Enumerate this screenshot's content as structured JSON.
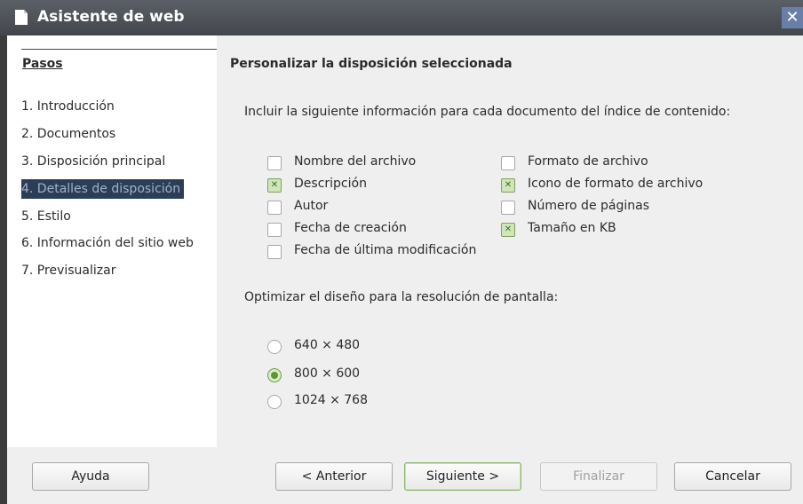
{
  "window": {
    "title": "Asistente de web",
    "close_glyph": "✕"
  },
  "steps": {
    "heading": "Pasos",
    "items": [
      {
        "label": "1. Introducción",
        "active": false
      },
      {
        "label": "2. Documentos",
        "active": false
      },
      {
        "label": "3. Disposición principal",
        "active": false
      },
      {
        "label": "4. Detalles de disposición",
        "active": true
      },
      {
        "label": "5. Estilo",
        "active": false
      },
      {
        "label": "6. Información del sitio web",
        "active": false
      },
      {
        "label": "7. Previsualizar",
        "active": false
      }
    ]
  },
  "main": {
    "title": "Personalizar la disposición seleccionada",
    "include_label": "Incluir la siguiente información para cada documento del índice de contenido:",
    "checkboxes": [
      {
        "label": "Nombre del archivo",
        "checked": false
      },
      {
        "label": "Descripción",
        "checked": true
      },
      {
        "label": "Autor",
        "checked": false
      },
      {
        "label": "Fecha de creación",
        "checked": false
      },
      {
        "label": "Fecha de última modificación",
        "checked": false
      },
      {
        "label": "Formato de archivo",
        "checked": false
      },
      {
        "label": "Icono de formato de archivo",
        "checked": true
      },
      {
        "label": "Número de páginas",
        "checked": false
      },
      {
        "label": "Tamaño en KB",
        "checked": true
      }
    ],
    "resolution_label": "Optimizar el diseño para la resolución de pantalla:",
    "resolutions": [
      {
        "label": "640 × 480",
        "selected": false
      },
      {
        "label": "800 × 600",
        "selected": true
      },
      {
        "label": "1024 × 768",
        "selected": false
      }
    ]
  },
  "buttons": {
    "help": "Ayuda",
    "back": "< Anterior",
    "next": "Siguiente >",
    "finish": "Finalizar",
    "cancel": "Cancelar"
  },
  "icons": {
    "window_icon": "document-icon",
    "close": "close-icon"
  },
  "colors": {
    "accent": "#6c9a44",
    "selection_bg": "#2c3e57",
    "titlebar": "#4e5258"
  }
}
